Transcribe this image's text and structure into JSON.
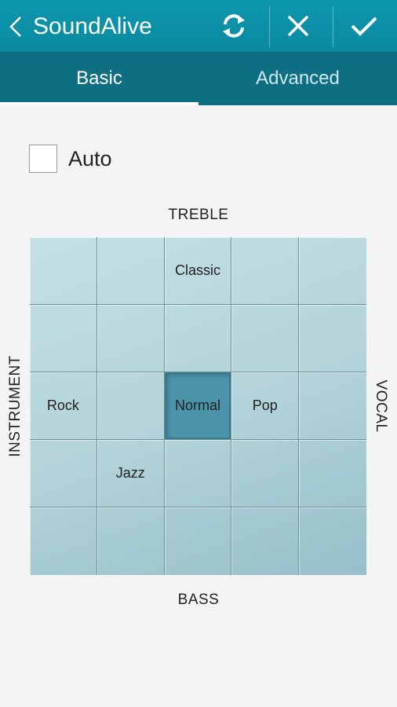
{
  "appbar": {
    "title": "SoundAlive",
    "icons": {
      "back": "chevron-left-icon",
      "refresh": "refresh-icon",
      "close": "close-icon",
      "done": "check-icon"
    }
  },
  "tabs": [
    {
      "label": "Basic",
      "selected": true
    },
    {
      "label": "Advanced",
      "selected": false
    }
  ],
  "auto": {
    "label": "Auto",
    "checked": false
  },
  "axes": {
    "top": "TREBLE",
    "bottom": "BASS",
    "left": "INSTRUMENT",
    "right": "VOCAL"
  },
  "grid": {
    "rows": [
      [
        "",
        "",
        "Classic",
        "",
        ""
      ],
      [
        "",
        "",
        "",
        "",
        ""
      ],
      [
        "Rock",
        "",
        "Normal",
        "Pop",
        ""
      ],
      [
        "",
        "Jazz",
        "",
        "",
        ""
      ],
      [
        "",
        "",
        "",
        "",
        ""
      ]
    ],
    "selected": "Normal"
  },
  "colors": {
    "appbar": "#0b8ea4",
    "tabbar": "#0e6f83",
    "grid": "#b8d8de",
    "selected_cell": "#4b93a9",
    "background": "#f4f4f4"
  }
}
